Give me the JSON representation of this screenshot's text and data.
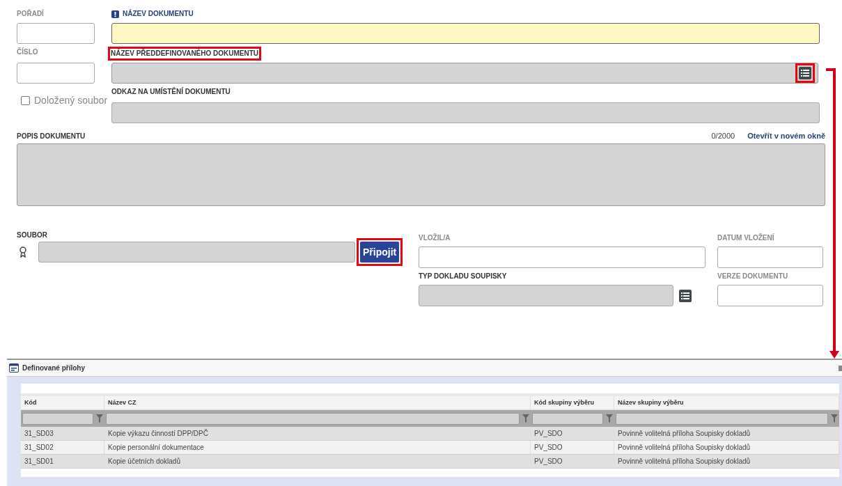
{
  "form": {
    "order": {
      "label": "POŘADÍ",
      "readonly": true
    },
    "number": {
      "label": "ČÍSLO",
      "readonly": true
    },
    "document_name": {
      "label": "NÁZEV DOKUMENTU",
      "required": true
    },
    "predefined_name": {
      "label": "NÁZEV PŘEDDEFINOVANÉHO DOKUMENTU",
      "highlighted": true,
      "disabled": true,
      "list_button_highlighted": true
    },
    "proven_file": {
      "label": "Doložený soubor",
      "checked": false
    },
    "location_link": {
      "label": "ODKAZ NA UMÍSTĚNÍ DOKUMENTU",
      "disabled": true
    },
    "description": {
      "label": "POPIS DOKUMENTU",
      "counter": "0/2000",
      "link": "Otevřít v novém okně",
      "disabled": true
    },
    "file": {
      "label": "SOUBOR",
      "disabled": true,
      "button": "Připojit",
      "button_highlighted": true
    },
    "inserted_by": {
      "label": "VLOŽIL/A",
      "readonly": true
    },
    "insert_date": {
      "label": "DATUM VLOŽENÍ",
      "readonly": true
    },
    "receipt_type": {
      "label": "TYP DOKLADU SOUPISKY",
      "disabled": true
    },
    "version": {
      "label": "VERZE DOKUMENTU",
      "readonly": true
    }
  },
  "dialog": {
    "title": "Definované přílohy",
    "columns": [
      "Kód",
      "Název CZ",
      "Kód skupiny výběru",
      "Název skupiny výběru"
    ],
    "rows": [
      [
        "31_SD03",
        "Kopie výkazu činností DPP/DPČ",
        "PV_SDO",
        "Povinně volitelná příloha Soupisky dokladů"
      ],
      [
        "31_SD02",
        "Kopie personální dokumentace",
        "PV_SDO",
        "Povinně volitelná příloha Soupisky dokladů"
      ],
      [
        "31_SD01",
        "Kopie účetních dokladů",
        "PV_SDO",
        "Povinně volitelná příloha Soupisky dokladů"
      ]
    ]
  }
}
